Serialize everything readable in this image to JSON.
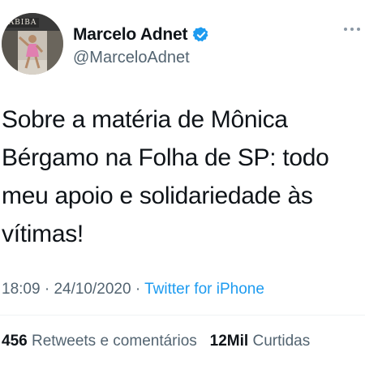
{
  "tweet": {
    "author": {
      "name": "Marcelo Adnet",
      "handle": "@MarceloAdnet",
      "avatar_sign_text": "ABIBA",
      "verified": true
    },
    "text": "Sobre a matéria de Mônica Bérgamo na Folha de SP: todo meu apoio e solidariedade às vítimas!",
    "time": "18:09",
    "date": "24/10/2020",
    "separator": "·",
    "source": "Twitter for iPhone",
    "stats": {
      "retweets_count": "456",
      "retweets_label": "Retweets e comentários",
      "likes_count": "12Mil",
      "likes_label": "Curtidas"
    }
  },
  "colors": {
    "link": "#1d9bf0",
    "secondary_text": "#536471",
    "primary_text": "#0f1419",
    "verified_badge": "#1d9bf0"
  },
  "icons": {
    "verified": "verified-badge-icon",
    "more": "more-horizontal-icon"
  }
}
